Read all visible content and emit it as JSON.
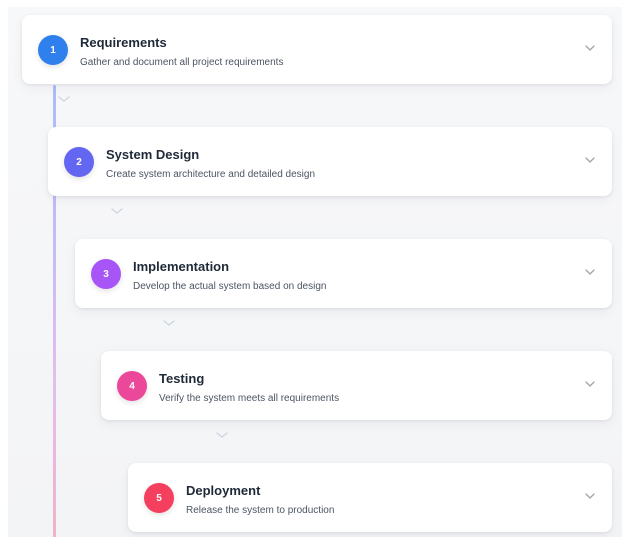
{
  "steps": [
    {
      "number": "1",
      "title": "Requirements",
      "description": "Gather and document all project requirements",
      "color": "#2f80ed"
    },
    {
      "number": "2",
      "title": "System Design",
      "description": "Create system architecture and detailed design",
      "color": "#6366f1"
    },
    {
      "number": "3",
      "title": "Implementation",
      "description": "Develop the actual system based on design",
      "color": "#a855f7"
    },
    {
      "number": "4",
      "title": "Testing",
      "description": "Verify the system meets all requirements",
      "color": "#ec4899"
    },
    {
      "number": "5",
      "title": "Deployment",
      "description": "Release the system to production",
      "color": "#f43f5e"
    }
  ],
  "icons": {
    "expand": "chevron-down-icon",
    "connector": "chevron-down-icon"
  }
}
